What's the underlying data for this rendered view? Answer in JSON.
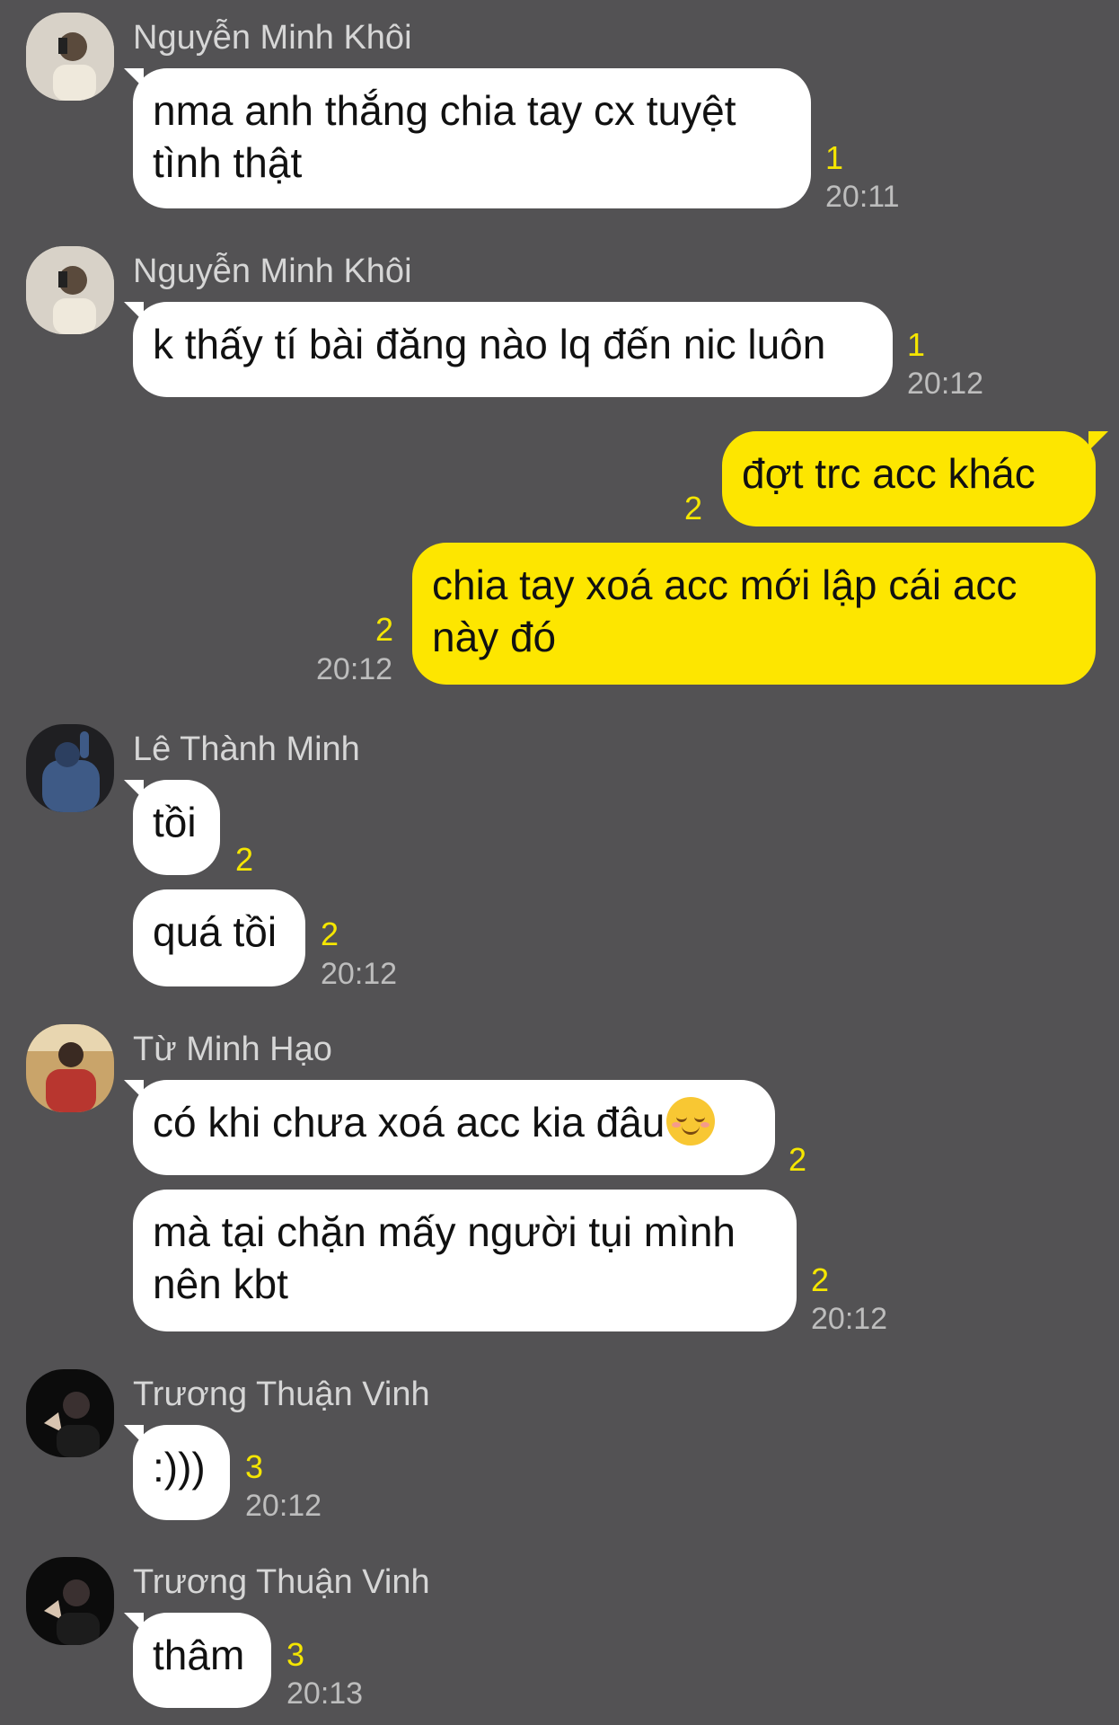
{
  "messages": [
    {
      "sender": "Nguyễn Minh Khôi",
      "lines": [
        "nma anh thắng chia tay cx tuyệt",
        "tình thật"
      ],
      "count": "1",
      "time": "20:11"
    },
    {
      "sender": "Nguyễn Minh Khôi",
      "lines": [
        "k thấy tí bài đăng nào lq đến nic luôn"
      ],
      "count": "1",
      "time": "20:12"
    },
    {
      "lines": [
        "đợt trc acc khác"
      ],
      "count": "2"
    },
    {
      "lines": [
        "chia tay xoá acc mới lập cái acc",
        "này đó"
      ],
      "count": "2",
      "time": "20:12"
    },
    {
      "sender": "Lê Thành Minh",
      "lines": [
        "tồi"
      ],
      "count": "2"
    },
    {
      "lines": [
        "quá tồi"
      ],
      "count": "2",
      "time": "20:12"
    },
    {
      "sender": "Từ Minh Hạo",
      "lines": [
        "có khi chưa xoá acc kia đâu"
      ],
      "emoji": "smiling-face-emoji",
      "count": "2"
    },
    {
      "lines": [
        "mà tại chặn mấy người tụi mình",
        "nên kbt"
      ],
      "count": "2",
      "time": "20:12"
    },
    {
      "sender": "Trương Thuận Vinh",
      "lines": [
        ":)))"
      ],
      "count": "3",
      "time": "20:12"
    },
    {
      "sender": "Trương Thuận Vinh",
      "lines": [
        "thâm"
      ],
      "count": "3",
      "time": "20:13"
    }
  ],
  "colors": {
    "background": "#535254",
    "incoming_bubble": "#ffffff",
    "outgoing_bubble": "#fde600",
    "unread_count": "#f5e600"
  }
}
